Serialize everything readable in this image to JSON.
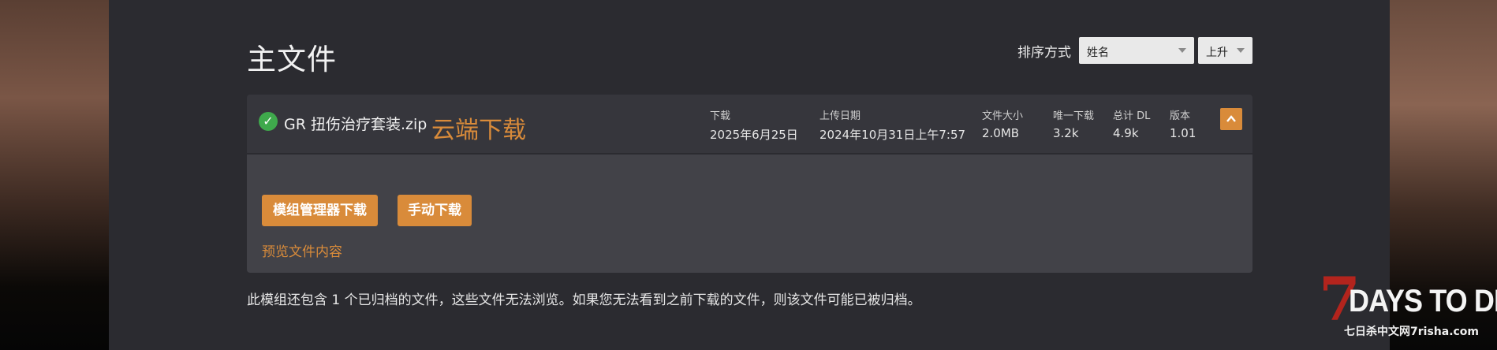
{
  "page": {
    "title": "主文件"
  },
  "sort": {
    "label": "排序方式",
    "by_value": "姓名",
    "order_value": "上升"
  },
  "file": {
    "name": "GR 扭伤治疗套装.zip",
    "cloud_download": "云端下载",
    "meta": {
      "downloaded": {
        "label": "下载",
        "value": "2025年6月25日"
      },
      "uploaded": {
        "label": "上传日期",
        "value": "2024年10月31日上午7:57"
      },
      "size": {
        "label": "文件大小",
        "value": "2.0MB"
      },
      "unique_dl": {
        "label": "唯一下载",
        "value": "3.2k"
      },
      "total_dl": {
        "label": "总计 DL",
        "value": "4.9k"
      },
      "version": {
        "label": "版本",
        "value": "1.01"
      }
    },
    "buttons": {
      "mod_manager": "模组管理器下载",
      "manual": "手动下载"
    },
    "preview_link": "预览文件内容"
  },
  "archive_note": "此模组还包含 1 个已归档的文件，这些文件无法浏览。如果您无法看到之前下载的文件，则该文件可能已被归档。",
  "watermark": {
    "seven": "7",
    "days": "DAYS TO DIE",
    "sub": "七日杀中文网7risha.com"
  },
  "colors": {
    "accent": "#d98b3a",
    "success": "#3fa94c",
    "panel": "#36363c",
    "panel_body": "#424248"
  },
  "icons": {
    "check": "check-circle-icon",
    "collapse": "chevron-up-icon",
    "caret": "caret-down-icon"
  }
}
